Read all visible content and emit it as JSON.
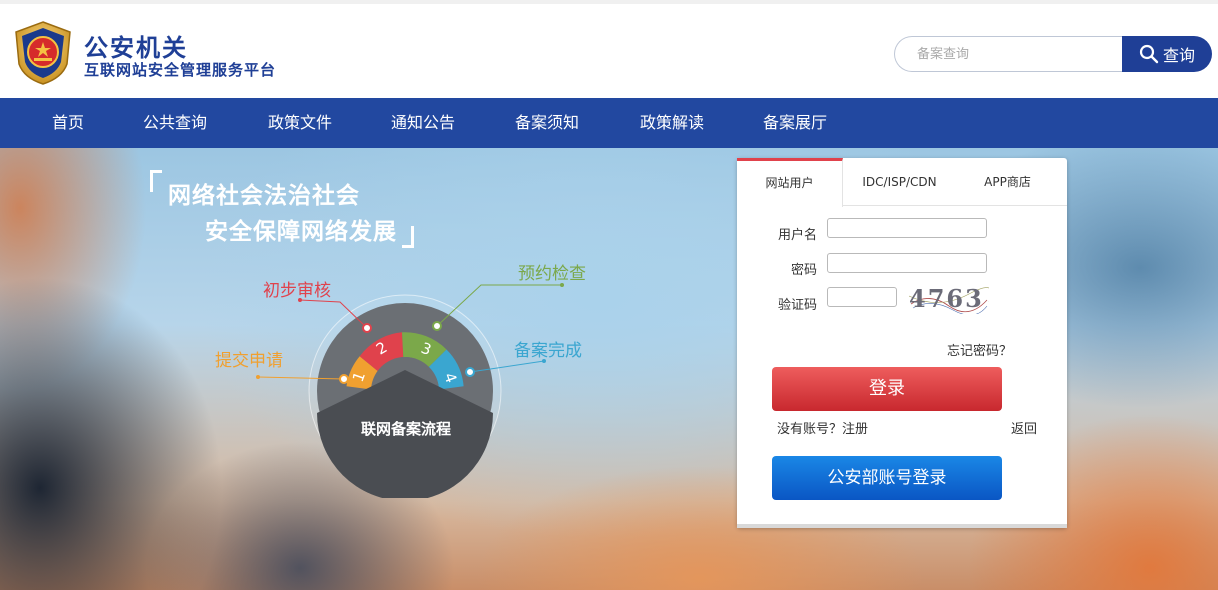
{
  "header": {
    "title": "公安机关",
    "subtitle": "互联网站安全管理服务平台",
    "logo_icon": "police-emblem-icon",
    "search": {
      "placeholder": "备案查询",
      "button_label": "查询",
      "icon": "search-icon"
    }
  },
  "nav": {
    "items": [
      {
        "label": "首页"
      },
      {
        "label": "公共查询"
      },
      {
        "label": "政策文件"
      },
      {
        "label": "通知公告"
      },
      {
        "label": "备案须知"
      },
      {
        "label": "政策解读"
      },
      {
        "label": "备案展厅"
      }
    ]
  },
  "hero": {
    "slogan_line1": "网络社会法治社会",
    "slogan_line2": "安全保障网络发展",
    "flow": {
      "center_label": "联网备案流程",
      "steps": [
        {
          "number": "1",
          "label": "提交申请",
          "color": "#f0a030"
        },
        {
          "number": "2",
          "label": "初步审核",
          "color": "#e0424c"
        },
        {
          "number": "3",
          "label": "预约检查",
          "color": "#7ba84a"
        },
        {
          "number": "4",
          "label": "备案完成",
          "color": "#3aa6d0"
        }
      ]
    }
  },
  "login": {
    "tabs": [
      {
        "label": "网站用户",
        "active": true
      },
      {
        "label": "IDC/ISP/CDN",
        "active": false
      },
      {
        "label": "APP商店",
        "active": false
      }
    ],
    "username_label": "用户名",
    "password_label": "密码",
    "captcha_label": "验证码",
    "captcha_text": "4763",
    "forgot_password": "忘记密码？",
    "login_button": "登录",
    "register_link": "没有账号？注册",
    "back_link": "返回",
    "mps_login_button": "公安部账号登录",
    "colors": {
      "accent_red": "#e0424c",
      "brand_blue": "#2248a0"
    }
  }
}
